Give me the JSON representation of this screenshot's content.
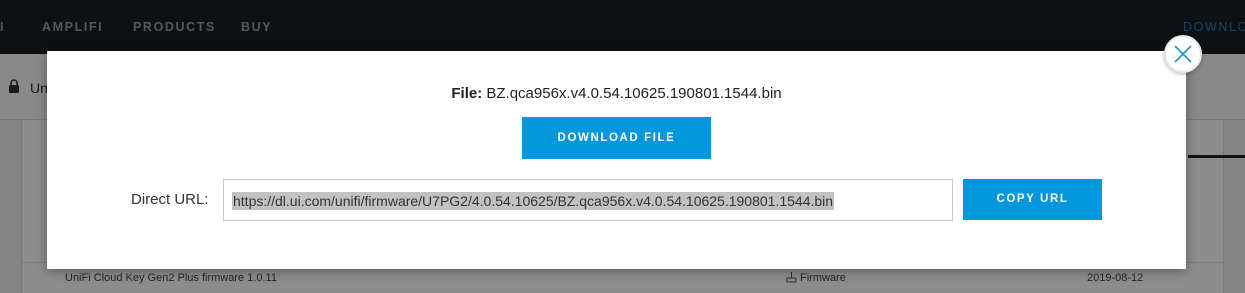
{
  "nav": {
    "items": [
      "I",
      "AMPLIFI",
      "PRODUCTS",
      "BUY"
    ],
    "right_item": "DOWNLO"
  },
  "subbar": {
    "text": "Un",
    "icon": "lock-icon"
  },
  "table_row": {
    "name": "UniFi Cloud Key Gen2 Plus firmware 1.0.11",
    "type": "Firmware",
    "type_icon": "firmware-icon",
    "date": "2019-08-12"
  },
  "modal": {
    "file_label": "File:",
    "file_name": "BZ.qca956x.v4.0.54.10625.190801.1544.bin",
    "download_button": "DOWNLOAD FILE",
    "url_label": "Direct URL:",
    "url_value": "https://dl.ui.com/unifi/firmware/U7PG2/4.0.54.10625/BZ.qca956x.v4.0.54.10625.190801.1544.bin",
    "copy_button": "COPY URL",
    "close_icon": "close-icon"
  },
  "colors": {
    "accent": "#0097dc",
    "nav_bg": "#1b2026"
  }
}
